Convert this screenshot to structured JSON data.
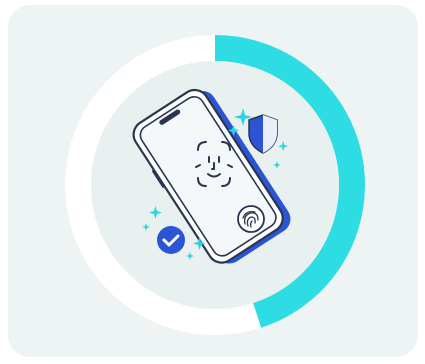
{
  "progress": {
    "value": 0.45,
    "track_color": "#ffffff",
    "fill_color": "#2edde3"
  },
  "colors": {
    "card_background": "#eef3f3",
    "inner_circle": "#e9f0f0",
    "outline": "#2a3552",
    "accent_blue": "#2c55d6",
    "accent_cyan": "#29d6e0",
    "phone_screen": "#f4f8fa"
  },
  "icons": {
    "phone": "smartphone-icon",
    "face_scan": "face-id-icon",
    "fingerprint": "fingerprint-icon",
    "shield": "shield-icon",
    "check": "checkmark-circle-icon",
    "sparkles": "sparkle-icon"
  }
}
